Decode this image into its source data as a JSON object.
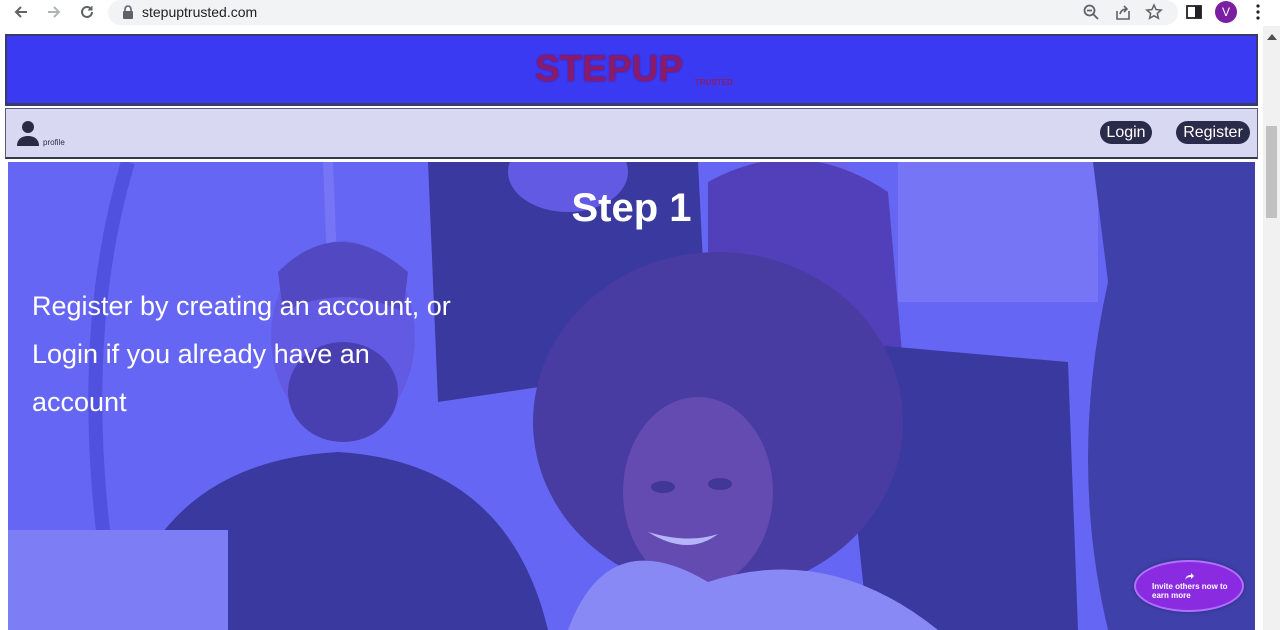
{
  "browser": {
    "url": "stepuptrusted.com",
    "avatar_letter": "V",
    "icons": [
      "back-icon",
      "forward-icon",
      "reload-icon",
      "lock-icon",
      "zoom-icon",
      "share-icon",
      "star-icon",
      "side-panel-icon",
      "menu-icon"
    ]
  },
  "header": {
    "logo": "STEPUP",
    "logo_sub": "TRUSTED",
    "brand_color": "#3a3af2",
    "logo_color": "#8a1a6a"
  },
  "nav": {
    "profile_label": "profile",
    "login_label": "Login",
    "register_label": "Register"
  },
  "hero": {
    "title": "Step 1",
    "text": "Register by creating an account, or Login if you already have an account",
    "overlay_color": "#5a5af5"
  },
  "invite": {
    "label": "Invite others now to earn more",
    "color": "#8a2be2"
  }
}
